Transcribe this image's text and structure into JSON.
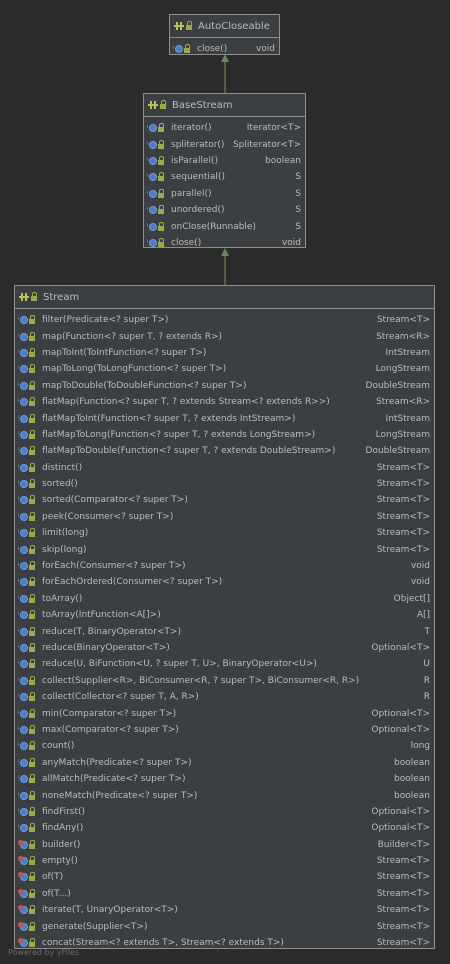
{
  "colors": {
    "background": "#2b2b2b",
    "box_fill": "#3c3f41",
    "box_border": "#8e8e8e",
    "arrow": "#6a8759",
    "method_icon": "#4f7dc4",
    "static_marker": "#c75450"
  },
  "diagram": {
    "auto_closeable": {
      "name": "AutoCloseable",
      "methods": [
        {
          "sig": "close()",
          "ret": "void"
        }
      ]
    },
    "base_stream": {
      "name": "BaseStream",
      "methods": [
        {
          "sig": "iterator()",
          "ret": "Iterator<T>"
        },
        {
          "sig": "spliterator()",
          "ret": "Spliterator<T>"
        },
        {
          "sig": "isParallel()",
          "ret": "boolean"
        },
        {
          "sig": "sequential()",
          "ret": "S"
        },
        {
          "sig": "parallel()",
          "ret": "S"
        },
        {
          "sig": "unordered()",
          "ret": "S"
        },
        {
          "sig": "onClose(Runnable)",
          "ret": "S"
        },
        {
          "sig": "close()",
          "ret": "void"
        }
      ]
    },
    "stream": {
      "name": "Stream",
      "methods": [
        {
          "sig": "filter(Predicate<? super T>)",
          "ret": "Stream<T>"
        },
        {
          "sig": "map(Function<? super T, ? extends R>)",
          "ret": "Stream<R>"
        },
        {
          "sig": "mapToInt(ToIntFunction<? super T>)",
          "ret": "IntStream"
        },
        {
          "sig": "mapToLong(ToLongFunction<? super T>)",
          "ret": "LongStream"
        },
        {
          "sig": "mapToDouble(ToDoubleFunction<? super T>)",
          "ret": "DoubleStream"
        },
        {
          "sig": "flatMap(Function<? super T, ? extends Stream<? extends R>>)",
          "ret": "Stream<R>"
        },
        {
          "sig": "flatMapToInt(Function<? super T, ? extends IntStream>)",
          "ret": "IntStream"
        },
        {
          "sig": "flatMapToLong(Function<? super T, ? extends LongStream>)",
          "ret": "LongStream"
        },
        {
          "sig": "flatMapToDouble(Function<? super T, ? extends DoubleStream>)",
          "ret": "DoubleStream"
        },
        {
          "sig": "distinct()",
          "ret": "Stream<T>"
        },
        {
          "sig": "sorted()",
          "ret": "Stream<T>"
        },
        {
          "sig": "sorted(Comparator<? super T>)",
          "ret": "Stream<T>"
        },
        {
          "sig": "peek(Consumer<? super T>)",
          "ret": "Stream<T>"
        },
        {
          "sig": "limit(long)",
          "ret": "Stream<T>"
        },
        {
          "sig": "skip(long)",
          "ret": "Stream<T>"
        },
        {
          "sig": "forEach(Consumer<? super T>)",
          "ret": "void"
        },
        {
          "sig": "forEachOrdered(Consumer<? super T>)",
          "ret": "void"
        },
        {
          "sig": "toArray()",
          "ret": "Object[]"
        },
        {
          "sig": "toArray(IntFunction<A[]>)",
          "ret": "A[]"
        },
        {
          "sig": "reduce(T, BinaryOperator<T>)",
          "ret": "T"
        },
        {
          "sig": "reduce(BinaryOperator<T>)",
          "ret": "Optional<T>"
        },
        {
          "sig": "reduce(U, BiFunction<U, ? super T, U>, BinaryOperator<U>)",
          "ret": "U"
        },
        {
          "sig": "collect(Supplier<R>, BiConsumer<R, ? super T>, BiConsumer<R, R>)",
          "ret": "R"
        },
        {
          "sig": "collect(Collector<? super T, A, R>)",
          "ret": "R"
        },
        {
          "sig": "min(Comparator<? super T>)",
          "ret": "Optional<T>"
        },
        {
          "sig": "max(Comparator<? super T>)",
          "ret": "Optional<T>"
        },
        {
          "sig": "count()",
          "ret": "long"
        },
        {
          "sig": "anyMatch(Predicate<? super T>)",
          "ret": "boolean"
        },
        {
          "sig": "allMatch(Predicate<? super T>)",
          "ret": "boolean"
        },
        {
          "sig": "noneMatch(Predicate<? super T>)",
          "ret": "boolean"
        },
        {
          "sig": "findFirst()",
          "ret": "Optional<T>"
        },
        {
          "sig": "findAny()",
          "ret": "Optional<T>"
        },
        {
          "sig": "builder()",
          "ret": "Builder<T>",
          "static": true
        },
        {
          "sig": "empty()",
          "ret": "Stream<T>",
          "static": true
        },
        {
          "sig": "of(T)",
          "ret": "Stream<T>",
          "static": true
        },
        {
          "sig": "of(T...)",
          "ret": "Stream<T>",
          "static": true
        },
        {
          "sig": "iterate(T, UnaryOperator<T>)",
          "ret": "Stream<T>",
          "static": true
        },
        {
          "sig": "generate(Supplier<T>)",
          "ret": "Stream<T>",
          "static": true
        },
        {
          "sig": "concat(Stream<? extends T>, Stream<? extends T>)",
          "ret": "Stream<T>",
          "static": true
        }
      ]
    }
  },
  "footer": "Powered by yFiles"
}
